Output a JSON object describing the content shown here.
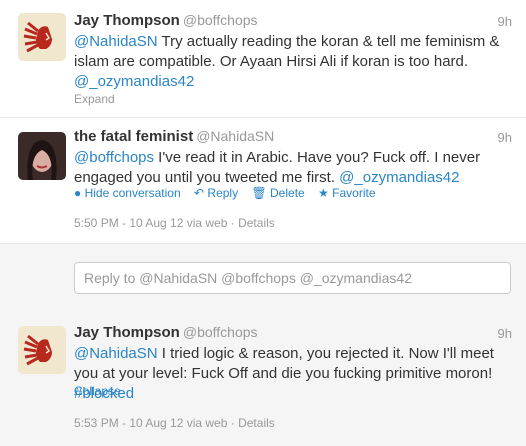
{
  "tweet1": {
    "name": "Jay Thompson",
    "handle": "@boffchops",
    "time": "9h",
    "mention": "@NahidaSN",
    "text_part1": " Try actually reading the koran & tell me feminism & islam are compatible. Or Ayaan Hirsi Ali if koran is too hard. ",
    "mention2": "@_ozymandias42",
    "expand": "Expand"
  },
  "tweet2": {
    "name": "the fatal feminist",
    "handle": "@NahidaSN",
    "time": "9h",
    "mention": "@boffchops",
    "text_part1": " I've read it in Arabic. Have you? Fuck off. I never engaged you until you tweeted me first. ",
    "mention2": "@_ozymandias42",
    "actions": {
      "hide": "Hide conversation",
      "reply": "Reply",
      "delete": "Delete",
      "favorite": "Favorite"
    },
    "meta": "5:50 PM - 10 Aug 12 via web · Details"
  },
  "reply": {
    "placeholder": "Reply to @NahidaSN @boffchops @_ozymandias42"
  },
  "tweet3": {
    "name": "Jay Thompson",
    "handle": "@boffchops",
    "time": "9h",
    "mention": "@NahidaSN",
    "text_part1": " I tried logic & reason, you rejected it. Now I'll meet you at your level: Fuck Off and die you fucking primitive moron! ",
    "hashtag": "#blocked",
    "collapse": "Collapse",
    "meta": "5:53 PM - 10 Aug 12 via web · Details"
  },
  "colors": {
    "link": "#2a85c7",
    "muted": "#999999",
    "text": "#333333"
  }
}
